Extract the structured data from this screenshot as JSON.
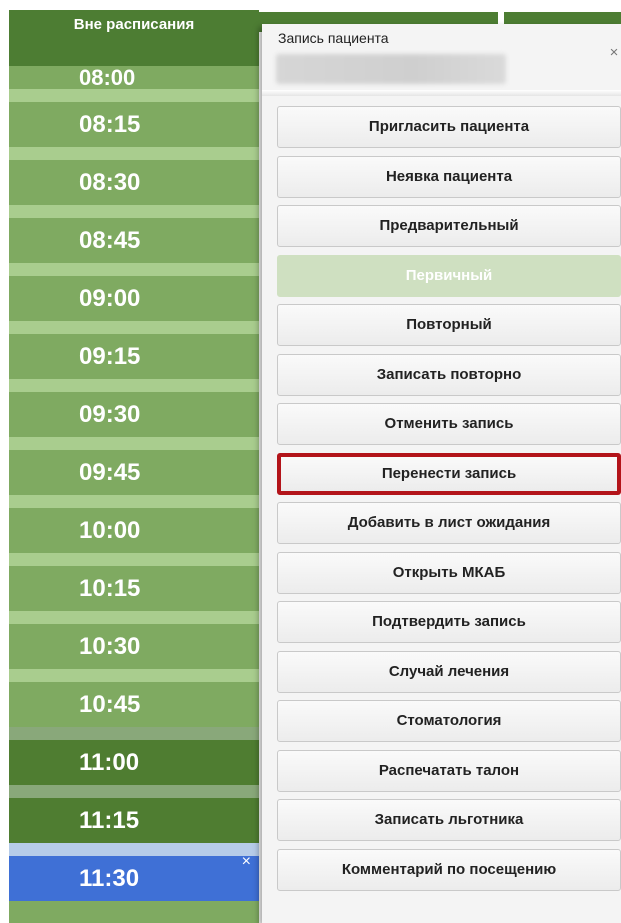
{
  "schedule": {
    "header": "Вне расписания",
    "slots": [
      "08:00",
      "08:15",
      "08:30",
      "08:45",
      "09:00",
      "09:15",
      "09:30",
      "09:45",
      "10:00",
      "10:15",
      "10:30",
      "10:45",
      "11:00",
      "11:15",
      "11:30"
    ],
    "selected_close_icon": "×"
  },
  "popup": {
    "title": "Запись пациента",
    "close_icon": "×",
    "actions": [
      "Пригласить пациента",
      "Неявка пациента",
      "Предварительный",
      "Первичный",
      "Повторный",
      "Записать повторно",
      "Отменить запись",
      "Перенести запись",
      "Добавить в лист ожидания",
      "Открыть МКАБ",
      "Подтвердить запись",
      "Случай лечения",
      "Стоматология",
      "Распечатать талон",
      "Записать льготника",
      "Комментарий по посещению"
    ]
  },
  "colors": {
    "header_green": "#4d7d33",
    "slot_green": "#7faa61",
    "slot_booked": "#4f7d31",
    "slot_selected": "#3f70d6",
    "highlight_border": "#b3141a"
  }
}
